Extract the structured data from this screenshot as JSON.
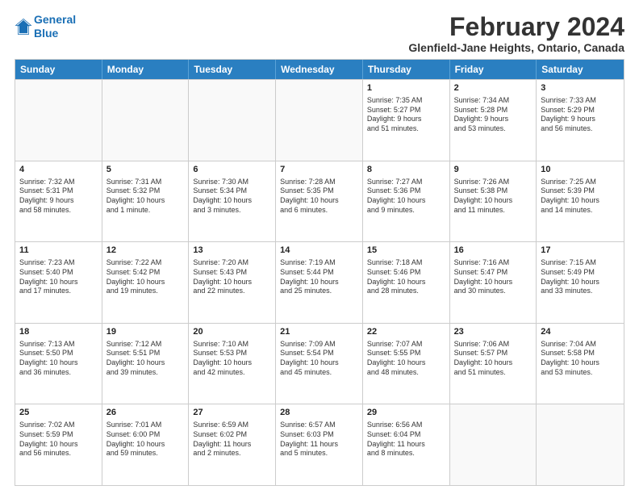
{
  "logo": {
    "line1": "General",
    "line2": "Blue"
  },
  "title": "February 2024",
  "location": "Glenfield-Jane Heights, Ontario, Canada",
  "header_days": [
    "Sunday",
    "Monday",
    "Tuesday",
    "Wednesday",
    "Thursday",
    "Friday",
    "Saturday"
  ],
  "rows": [
    [
      {
        "day": "",
        "text": ""
      },
      {
        "day": "",
        "text": ""
      },
      {
        "day": "",
        "text": ""
      },
      {
        "day": "",
        "text": ""
      },
      {
        "day": "1",
        "text": "Sunrise: 7:35 AM\nSunset: 5:27 PM\nDaylight: 9 hours\nand 51 minutes."
      },
      {
        "day": "2",
        "text": "Sunrise: 7:34 AM\nSunset: 5:28 PM\nDaylight: 9 hours\nand 53 minutes."
      },
      {
        "day": "3",
        "text": "Sunrise: 7:33 AM\nSunset: 5:29 PM\nDaylight: 9 hours\nand 56 minutes."
      }
    ],
    [
      {
        "day": "4",
        "text": "Sunrise: 7:32 AM\nSunset: 5:31 PM\nDaylight: 9 hours\nand 58 minutes."
      },
      {
        "day": "5",
        "text": "Sunrise: 7:31 AM\nSunset: 5:32 PM\nDaylight: 10 hours\nand 1 minute."
      },
      {
        "day": "6",
        "text": "Sunrise: 7:30 AM\nSunset: 5:34 PM\nDaylight: 10 hours\nand 3 minutes."
      },
      {
        "day": "7",
        "text": "Sunrise: 7:28 AM\nSunset: 5:35 PM\nDaylight: 10 hours\nand 6 minutes."
      },
      {
        "day": "8",
        "text": "Sunrise: 7:27 AM\nSunset: 5:36 PM\nDaylight: 10 hours\nand 9 minutes."
      },
      {
        "day": "9",
        "text": "Sunrise: 7:26 AM\nSunset: 5:38 PM\nDaylight: 10 hours\nand 11 minutes."
      },
      {
        "day": "10",
        "text": "Sunrise: 7:25 AM\nSunset: 5:39 PM\nDaylight: 10 hours\nand 14 minutes."
      }
    ],
    [
      {
        "day": "11",
        "text": "Sunrise: 7:23 AM\nSunset: 5:40 PM\nDaylight: 10 hours\nand 17 minutes."
      },
      {
        "day": "12",
        "text": "Sunrise: 7:22 AM\nSunset: 5:42 PM\nDaylight: 10 hours\nand 19 minutes."
      },
      {
        "day": "13",
        "text": "Sunrise: 7:20 AM\nSunset: 5:43 PM\nDaylight: 10 hours\nand 22 minutes."
      },
      {
        "day": "14",
        "text": "Sunrise: 7:19 AM\nSunset: 5:44 PM\nDaylight: 10 hours\nand 25 minutes."
      },
      {
        "day": "15",
        "text": "Sunrise: 7:18 AM\nSunset: 5:46 PM\nDaylight: 10 hours\nand 28 minutes."
      },
      {
        "day": "16",
        "text": "Sunrise: 7:16 AM\nSunset: 5:47 PM\nDaylight: 10 hours\nand 30 minutes."
      },
      {
        "day": "17",
        "text": "Sunrise: 7:15 AM\nSunset: 5:49 PM\nDaylight: 10 hours\nand 33 minutes."
      }
    ],
    [
      {
        "day": "18",
        "text": "Sunrise: 7:13 AM\nSunset: 5:50 PM\nDaylight: 10 hours\nand 36 minutes."
      },
      {
        "day": "19",
        "text": "Sunrise: 7:12 AM\nSunset: 5:51 PM\nDaylight: 10 hours\nand 39 minutes."
      },
      {
        "day": "20",
        "text": "Sunrise: 7:10 AM\nSunset: 5:53 PM\nDaylight: 10 hours\nand 42 minutes."
      },
      {
        "day": "21",
        "text": "Sunrise: 7:09 AM\nSunset: 5:54 PM\nDaylight: 10 hours\nand 45 minutes."
      },
      {
        "day": "22",
        "text": "Sunrise: 7:07 AM\nSunset: 5:55 PM\nDaylight: 10 hours\nand 48 minutes."
      },
      {
        "day": "23",
        "text": "Sunrise: 7:06 AM\nSunset: 5:57 PM\nDaylight: 10 hours\nand 51 minutes."
      },
      {
        "day": "24",
        "text": "Sunrise: 7:04 AM\nSunset: 5:58 PM\nDaylight: 10 hours\nand 53 minutes."
      }
    ],
    [
      {
        "day": "25",
        "text": "Sunrise: 7:02 AM\nSunset: 5:59 PM\nDaylight: 10 hours\nand 56 minutes."
      },
      {
        "day": "26",
        "text": "Sunrise: 7:01 AM\nSunset: 6:00 PM\nDaylight: 10 hours\nand 59 minutes."
      },
      {
        "day": "27",
        "text": "Sunrise: 6:59 AM\nSunset: 6:02 PM\nDaylight: 11 hours\nand 2 minutes."
      },
      {
        "day": "28",
        "text": "Sunrise: 6:57 AM\nSunset: 6:03 PM\nDaylight: 11 hours\nand 5 minutes."
      },
      {
        "day": "29",
        "text": "Sunrise: 6:56 AM\nSunset: 6:04 PM\nDaylight: 11 hours\nand 8 minutes."
      },
      {
        "day": "",
        "text": ""
      },
      {
        "day": "",
        "text": ""
      }
    ]
  ]
}
